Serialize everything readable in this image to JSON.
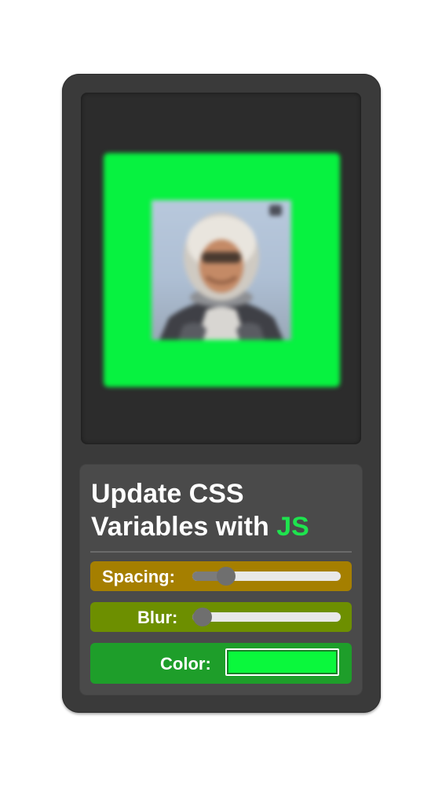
{
  "panel": {
    "title_prefix": "Update CSS Variables with",
    "title_accent": "JS"
  },
  "controls": {
    "spacing": {
      "label": "Spacing:",
      "value_fraction": 0.23
    },
    "blur": {
      "label": "Blur:",
      "value_fraction": 0.07
    },
    "color": {
      "label": "Color:",
      "value": "#0af83c"
    }
  },
  "colors": {
    "frame": "#07f240",
    "accent_text": "#1ee34e",
    "spacing_bg": "#a57f00",
    "blur_bg": "#6d8f00",
    "color_bg": "#1e9e2a"
  },
  "image": {
    "subject": "astronaut-portrait"
  }
}
